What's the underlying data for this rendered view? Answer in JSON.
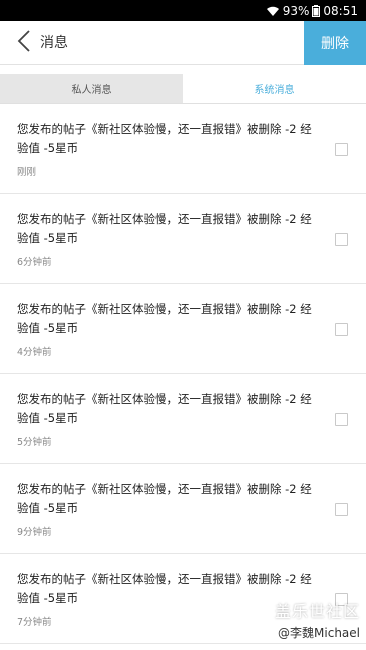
{
  "status_bar": {
    "battery_percent": "93%",
    "time": "08:51",
    "icons": [
      "wifi-icon",
      "battery-icon"
    ]
  },
  "header": {
    "title": "消息",
    "delete_label": "删除",
    "back_icon": "chevron-left-icon",
    "accent": "#4aaedb"
  },
  "tabs": [
    {
      "label": "私人消息",
      "active": false
    },
    {
      "label": "系统消息",
      "active": true
    }
  ],
  "messages": [
    {
      "text": "您发布的帖子《新社区体验慢，还一直报错》被删除 -2 经验值 -5星币",
      "time": "刚刚",
      "checked": false
    },
    {
      "text": "您发布的帖子《新社区体验慢，还一直报错》被删除 -2 经验值 -5星币",
      "time": "6分钟前",
      "checked": false
    },
    {
      "text": "您发布的帖子《新社区体验慢，还一直报错》被删除 -2 经验值 -5星币",
      "time": "4分钟前",
      "checked": false
    },
    {
      "text": "您发布的帖子《新社区体验慢，还一直报错》被删除 -2 经验值 -5星币",
      "time": "5分钟前",
      "checked": false
    },
    {
      "text": "您发布的帖子《新社区体验慢，还一直报错》被删除 -2 经验值 -5星币",
      "time": "9分钟前",
      "checked": false
    },
    {
      "text": "您发布的帖子《新社区体验慢，还一直报错》被删除 -2 经验值 -5星币",
      "time": "7分钟前",
      "checked": false
    }
  ],
  "watermark": {
    "title": "盖乐世社区",
    "user": "@李魏Michael"
  }
}
